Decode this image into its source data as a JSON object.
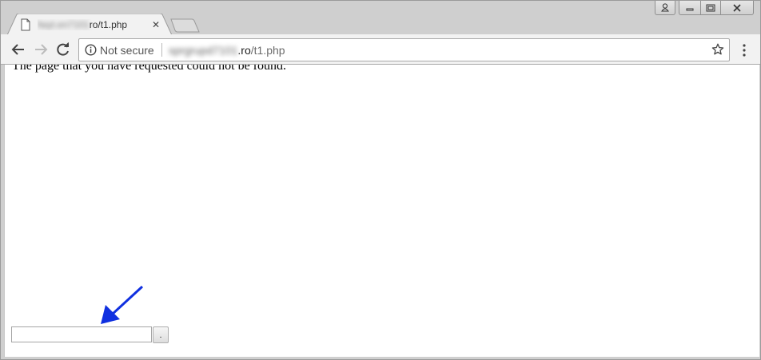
{
  "browser": {
    "tab": {
      "title_blurred": "fwyt.en7101",
      "title_suffix": "ro/t1.php",
      "close_icon": "close-icon",
      "favicon": "page-icon"
    },
    "window_controls": [
      "user-icon",
      "minimize-icon",
      "restore-icon",
      "close-icon"
    ],
    "omnibox": {
      "security_label": "Not secure",
      "url_blurred": "sprgrupd7101",
      "url_host_end": ".ro",
      "url_path": "/t1.php"
    }
  },
  "page": {
    "message": "The page that you have requested could not be found.",
    "search_input_value": "",
    "submit_label": "."
  },
  "annotation": {
    "arrow_color": "#1030e0"
  }
}
